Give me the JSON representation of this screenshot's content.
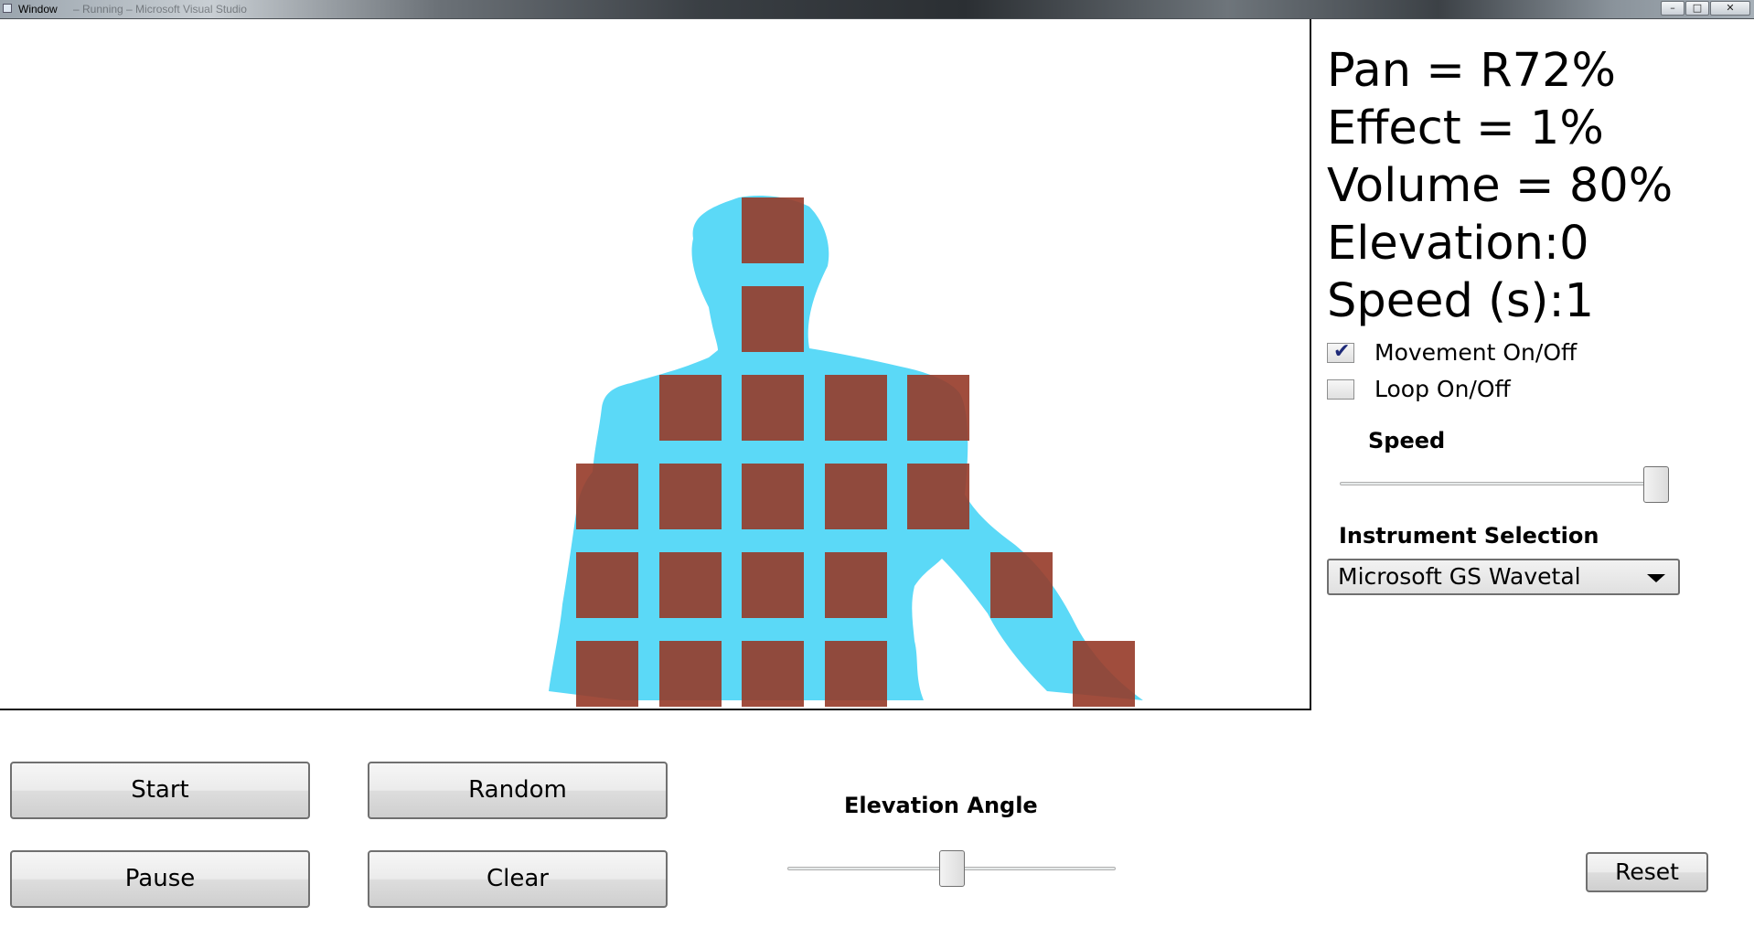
{
  "window": {
    "title": "Window",
    "title_faded": "– Running – Microsoft Visual Studio",
    "controls": [
      "minimize",
      "maximize",
      "close"
    ]
  },
  "info": {
    "pan": "Pan = R72%",
    "effect": "Effect = 1%",
    "volume": "Volume = 80%",
    "elevation": "Elevation:0",
    "speed": "Speed (s):1"
  },
  "options": {
    "movement": {
      "label": "Movement On/Off",
      "checked": true
    },
    "loop": {
      "label": "Loop On/Off",
      "checked": false
    }
  },
  "speed_slider": {
    "label": "Speed",
    "value_fraction": 1.0
  },
  "instrument": {
    "label": "Instrument Selection",
    "selected": "Microsoft GS Wavetal"
  },
  "elevation_slider": {
    "label": "Elevation Angle",
    "value_fraction": 0.5
  },
  "buttons": {
    "start": "Start",
    "random": "Random",
    "pause": "Pause",
    "clear": "Clear",
    "reset": "Reset"
  },
  "grid": {
    "active_cells": [
      [
        2,
        0
      ],
      [
        2,
        1
      ],
      [
        1,
        2
      ],
      [
        2,
        2
      ],
      [
        3,
        2
      ],
      [
        4,
        2
      ],
      [
        0,
        3
      ],
      [
        1,
        3
      ],
      [
        2,
        3
      ],
      [
        3,
        3
      ],
      [
        4,
        3
      ],
      [
        0,
        4
      ],
      [
        1,
        4
      ],
      [
        2,
        4
      ],
      [
        3,
        4
      ],
      [
        5,
        4
      ],
      [
        0,
        5
      ],
      [
        1,
        5
      ],
      [
        2,
        5
      ],
      [
        3,
        5
      ],
      [
        6,
        5
      ]
    ],
    "colors": {
      "body": "#5bd9f7",
      "cell": "#963a28"
    }
  }
}
